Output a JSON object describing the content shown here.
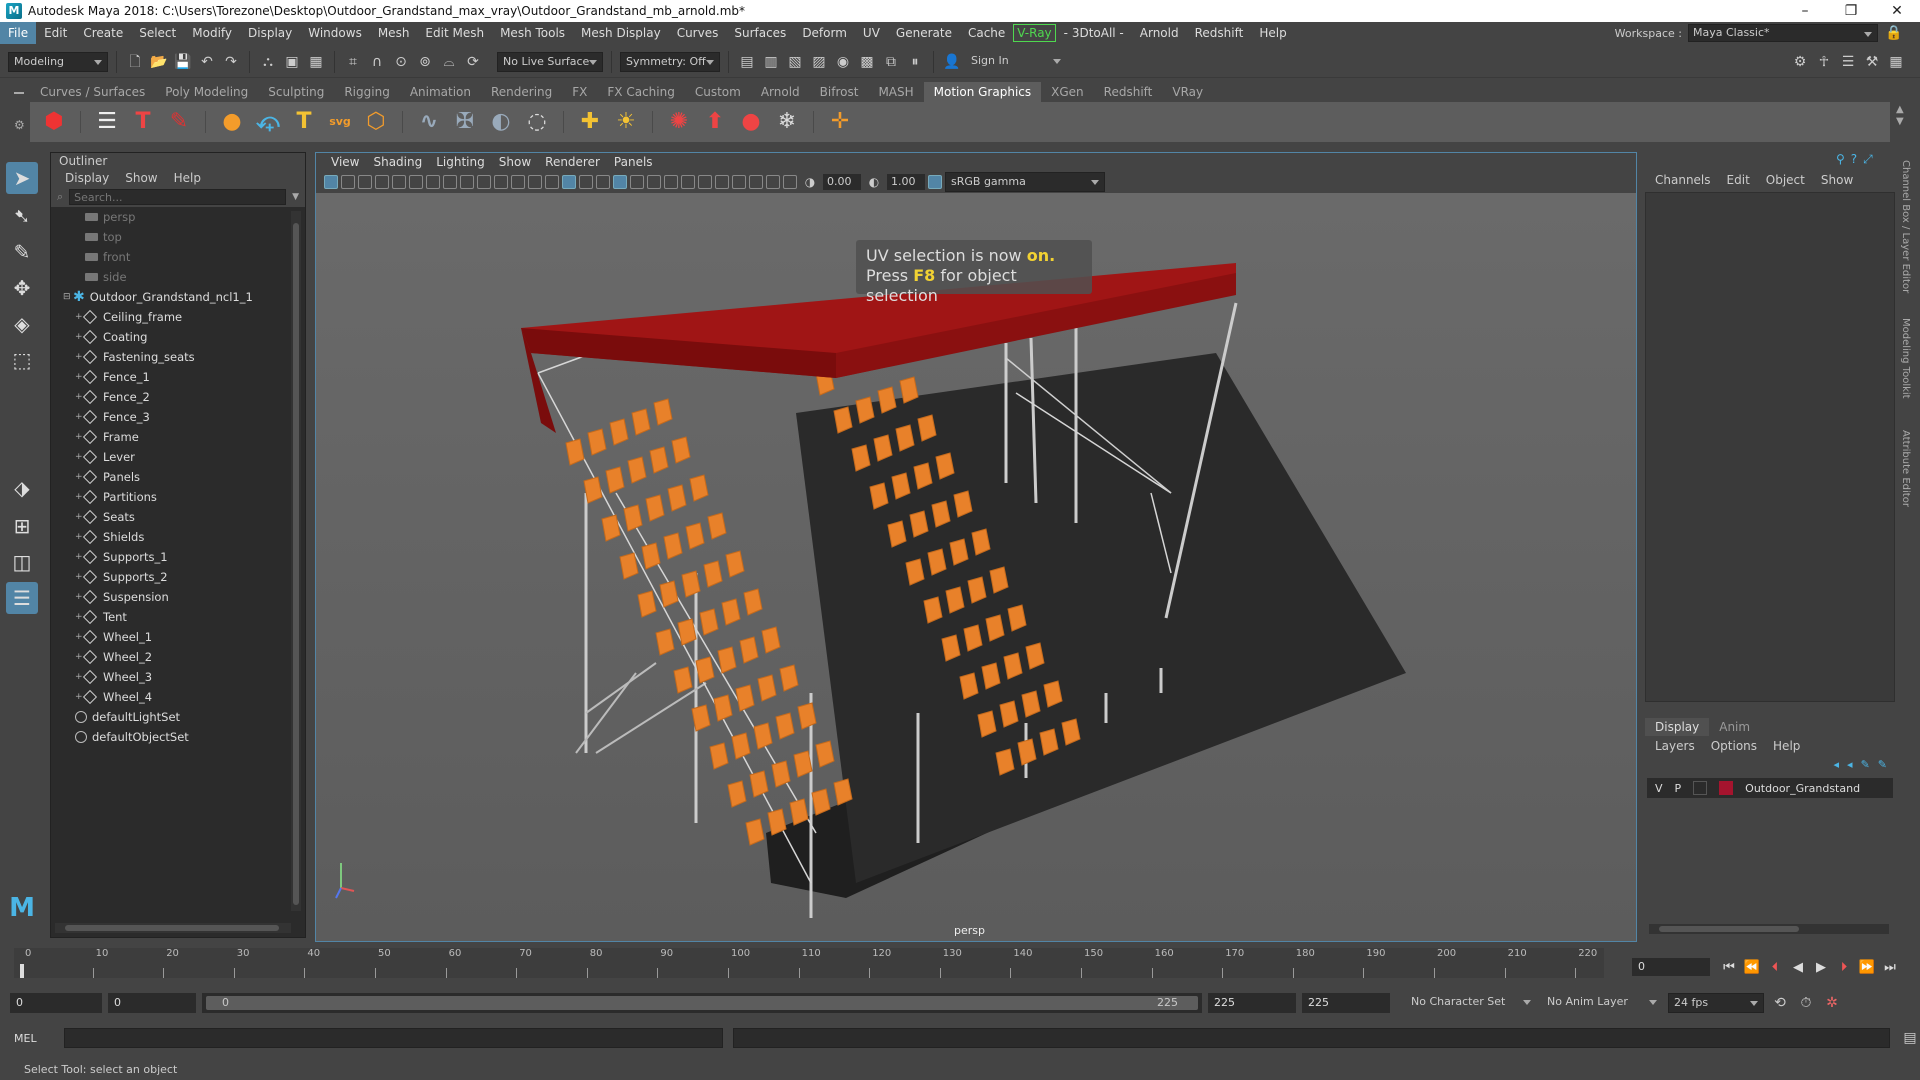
{
  "window": {
    "title": "Autodesk Maya 2018: C:\\Users\\Torezone\\Desktop\\Outdoor_Grandstand_max_vray\\Outdoor_Grandstand_mb_arnold.mb*",
    "minimize": "–",
    "restore": "❐",
    "close": "✕"
  },
  "menubar": {
    "items": [
      "File",
      "Edit",
      "Create",
      "Select",
      "Modify",
      "Display",
      "Windows",
      "Mesh",
      "Edit Mesh",
      "Mesh Tools",
      "Mesh Display",
      "Curves",
      "Surfaces",
      "Deform",
      "UV",
      "Generate",
      "Cache",
      "V-Ray",
      "- 3DtoAll -",
      "Arnold",
      "Redshift",
      "Help"
    ],
    "active": "File",
    "workspace_label": "Workspace :",
    "workspace_value": "Maya Classic*"
  },
  "statusline": {
    "mode": "Modeling",
    "live_surface": "No Live Surface",
    "symmetry": "Symmetry: Off",
    "sign_in": "Sign In"
  },
  "shelf": {
    "tabs": [
      "Curves / Surfaces",
      "Poly Modeling",
      "Sculpting",
      "Rigging",
      "Animation",
      "Rendering",
      "FX",
      "FX Caching",
      "Custom",
      "Arnold",
      "Bifrost",
      "MASH",
      "Motion Graphics",
      "XGen",
      "Redshift",
      "VRay"
    ],
    "active": "Motion Graphics"
  },
  "outliner": {
    "title": "Outliner",
    "menu": [
      "Display",
      "Show",
      "Help"
    ],
    "search_placeholder": "Search...",
    "cameras": [
      "persp",
      "top",
      "front",
      "side"
    ],
    "group": "Outdoor_Grandstand_ncl1_1",
    "children": [
      "Ceiling_frame",
      "Coating",
      "Fastening_seats",
      "Fence_1",
      "Fence_2",
      "Fence_3",
      "Frame",
      "Lever",
      "Panels",
      "Partitions",
      "Seats",
      "Shields",
      "Supports_1",
      "Supports_2",
      "Suspension",
      "Tent",
      "Wheel_1",
      "Wheel_2",
      "Wheel_3",
      "Wheel_4"
    ],
    "sets": [
      "defaultLightSet",
      "defaultObjectSet"
    ]
  },
  "viewport": {
    "menu": [
      "View",
      "Shading",
      "Lighting",
      "Show",
      "Renderer",
      "Panels"
    ],
    "exposure": "0.00",
    "gamma": "1.00",
    "colorspace": "sRGB gamma",
    "uv_msg_1a": "UV selection is now ",
    "uv_msg_1b": "on.",
    "uv_msg_2a": "Press ",
    "uv_msg_2b": "F8",
    "uv_msg_2c": " for object selection",
    "camera_label": "persp"
  },
  "channelbox": {
    "menu": [
      "Channels",
      "Edit",
      "Object",
      "Show"
    ]
  },
  "layers": {
    "tabs": [
      "Display",
      "Anim"
    ],
    "active_tab": "Display",
    "menu": [
      "Layers",
      "Options",
      "Help"
    ],
    "layer_v": "V",
    "layer_p": "P",
    "layer_name": "Outdoor_Grandstand",
    "layer_color": "#a5142e"
  },
  "side_tabs": [
    "Channel Box / Layer Editor",
    "Modeling Toolkit",
    "Attribute Editor"
  ],
  "timeline": {
    "ticks": [
      "0",
      "10",
      "20",
      "30",
      "40",
      "50",
      "60",
      "70",
      "80",
      "90",
      "100",
      "110",
      "120",
      "130",
      "140",
      "150",
      "160",
      "170",
      "180",
      "190",
      "200",
      "210",
      "220"
    ],
    "current_frame": "0"
  },
  "range": {
    "start": "0",
    "anim_start": "0",
    "slider_start": "0",
    "slider_end": "225",
    "anim_end": "225",
    "end": "225",
    "character_set": "No Character Set",
    "anim_layer": "No Anim Layer",
    "fps": "24 fps"
  },
  "cmdline": {
    "label": "MEL"
  },
  "helpline": {
    "text": "Select Tool: select an object"
  }
}
